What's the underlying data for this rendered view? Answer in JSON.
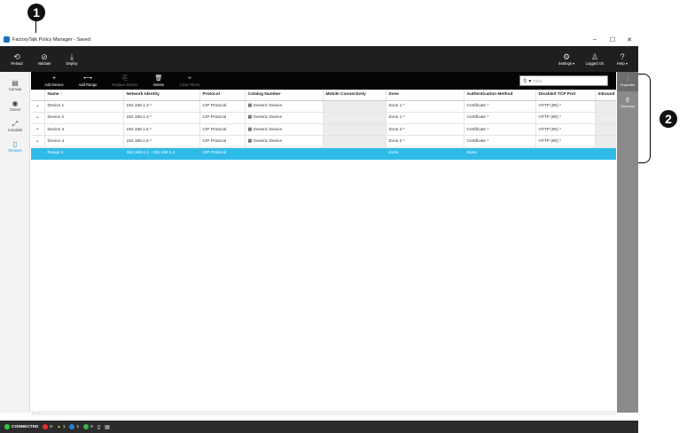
{
  "callouts": {
    "one": "1",
    "two": "2"
  },
  "window": {
    "title": "FactoryTalk Policy Manager - Saved",
    "controls": {
      "minimize": "–",
      "maximize": "☐",
      "close": "✕"
    }
  },
  "toolbar": {
    "reload": "Reload",
    "validate": "Validate",
    "deploy": "Deploy",
    "settings": "Settings",
    "logged_on": "Logged On",
    "help": "Help",
    "caret": "▾"
  },
  "left_sidebar": {
    "canvas": "Canvas",
    "zones": "Zones",
    "conduits": "Conduits",
    "devices": "Devices"
  },
  "subtoolbar": {
    "add_device": "Add Device",
    "add_range": "Add Range",
    "replace_device": "Replace Device",
    "delete": "Delete",
    "clear_filters": "Clear Filters"
  },
  "filter": {
    "placeholder": "Filter",
    "caret": "▾"
  },
  "right_sidebar": {
    "properties": "Properties",
    "discovery": "Discovery"
  },
  "table": {
    "columns": [
      "Name ↑",
      "Network Identity",
      "Protocol",
      "Catalog Number",
      "Mobile Connectivity",
      "Zone",
      "Authentication Method",
      "Disabled TCP Port",
      "Inbound"
    ],
    "rows": [
      {
        "marker": "•",
        "name": "Device 1",
        "network": "192.168.1.3 *",
        "protocol": "CIP Protocol",
        "catalog": "Generic Device",
        "mobile": "",
        "zone": "Zone 1 *",
        "auth": "Certificate *",
        "tcp": "HTTP (80) *",
        "inbound": ""
      },
      {
        "marker": "•",
        "name": "Device 2",
        "network": "192.168.1.4 *",
        "protocol": "CIP Protocol",
        "catalog": "Generic Device",
        "mobile": "",
        "zone": "Zone 1 *",
        "auth": "Certificate *",
        "tcp": "HTTP (80) *",
        "inbound": ""
      },
      {
        "marker": "•",
        "name": "Device 3",
        "network": "192.168.1.5 *",
        "protocol": "CIP Protocol",
        "catalog": "Generic Device",
        "mobile": "",
        "zone": "Zone 2 *",
        "auth": "Certificate *",
        "tcp": "HTTP (80) *",
        "inbound": ""
      },
      {
        "marker": "•",
        "name": "Device 4",
        "network": "192.168.1.6 *",
        "protocol": "CIP Protocol",
        "catalog": "Generic Device",
        "mobile": "",
        "zone": "Zone 2 *",
        "auth": "Certificate *",
        "tcp": "HTTP (80) *",
        "inbound": ""
      },
      {
        "marker": "",
        "name": "Range 1",
        "network": "192.168.1.1 - 192.168.1.2",
        "protocol": "CIP Protocol",
        "catalog": "",
        "mobile": "",
        "zone": "Zone",
        "auth": "None",
        "tcp": "",
        "inbound": ""
      }
    ]
  },
  "scroll": {
    "left": "‹",
    "right": "›"
  },
  "statusbar": {
    "connection": "CONNECTED",
    "errors": "0",
    "warnings": "1",
    "info": "1",
    "ok": "0"
  },
  "colors": {
    "selected_row": "#2fbbe8",
    "active_nav": "#1a8fd6",
    "connected": "#2ecc40"
  }
}
